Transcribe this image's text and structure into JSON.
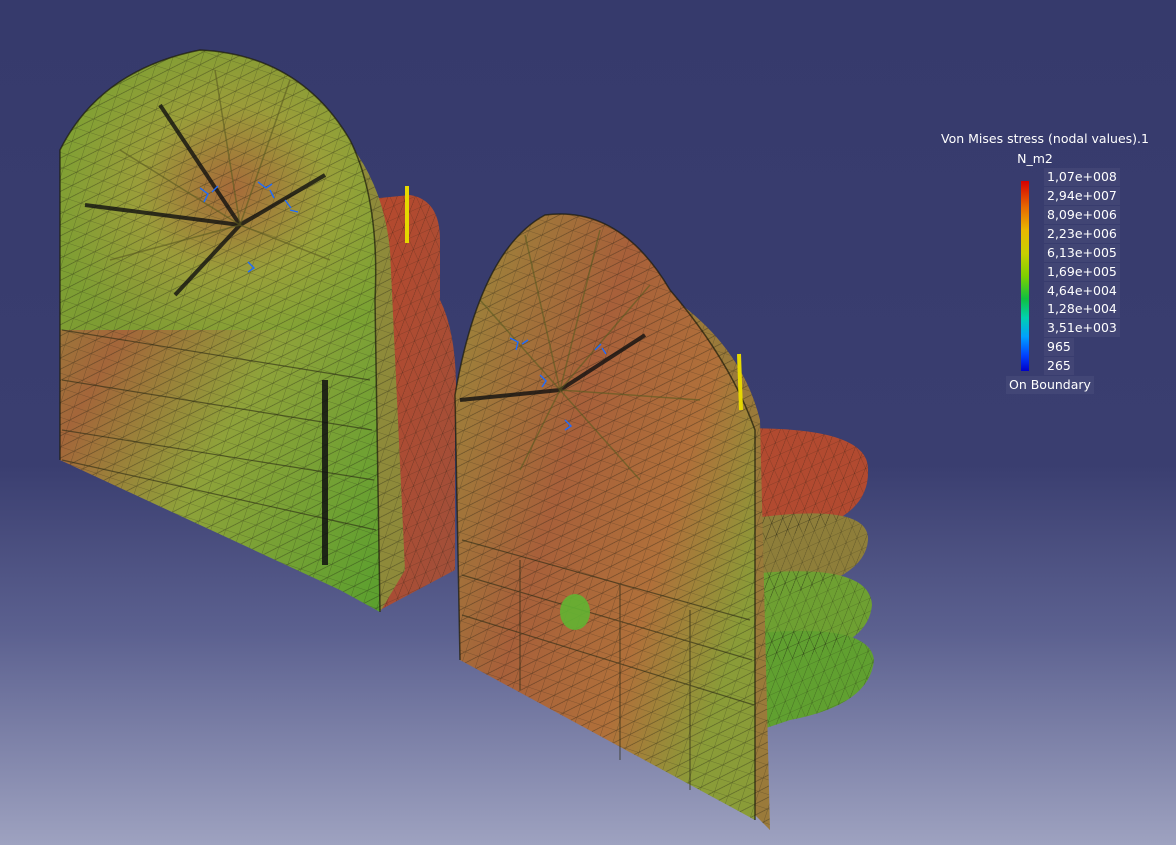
{
  "legend": {
    "title": "Von Mises stress (nodal values).1",
    "unit": "N_m2",
    "values": [
      "1,07e+008",
      "2,94e+007",
      "8,09e+006",
      "2,23e+006",
      "6,13e+005",
      "1,69e+005",
      "4,64e+004",
      "1,28e+004",
      "3,51e+003",
      "965",
      "265"
    ],
    "footer": "On Boundary"
  },
  "colors": {
    "background_top": "#363a6c",
    "background_bottom": "#9ea2c0",
    "mesh_high": "#c0392b",
    "mesh_mid": "#a2a13b",
    "mesh_low": "#4ea42d",
    "load_marker": "#e6d800"
  }
}
